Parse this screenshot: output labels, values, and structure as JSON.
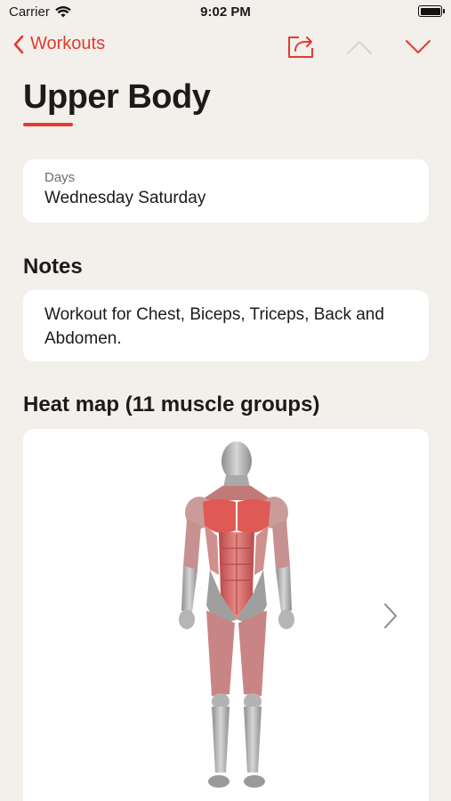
{
  "status_bar": {
    "carrier": "Carrier",
    "time": "9:02 PM"
  },
  "nav": {
    "back_label": "Workouts",
    "accent_color": "#e23b2f",
    "icons": [
      "chevron-left-icon",
      "share-icon",
      "chevron-up-icon",
      "chevron-down-icon"
    ]
  },
  "title": "Upper Body",
  "days": {
    "label": "Days",
    "value": "Wednesday Saturday"
  },
  "notes": {
    "heading": "Notes",
    "text": "Workout for Chest, Biceps, Triceps, Back and Abdomen."
  },
  "heat_map": {
    "heading": "Heat map (11 muscle groups)"
  }
}
